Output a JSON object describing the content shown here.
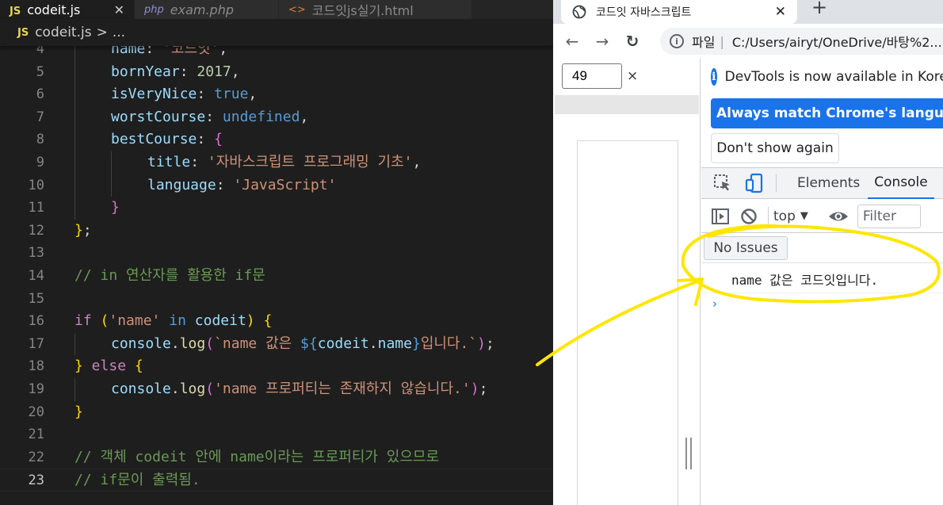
{
  "editor": {
    "tabs": [
      {
        "label": "codeit.js",
        "icon": "JS"
      },
      {
        "label": "exam.php",
        "icon": "php"
      },
      {
        "label": "코드잇js실기.html",
        "icon": "<>"
      }
    ],
    "close_glyph": "✕",
    "breadcrumb": {
      "icon": "JS",
      "file": "codeit.js",
      "sep": ">",
      "rest": "..."
    },
    "line_numbers": [
      "4",
      "5",
      "6",
      "7",
      "8",
      "9",
      "10",
      "11",
      "12",
      "13",
      "14",
      "15",
      "16",
      "17",
      "18",
      "19",
      "20",
      "21",
      "22",
      "23"
    ],
    "code": {
      "l4": {
        "prop": "name",
        "colon": ": ",
        "str": "'코드잇'",
        "end": ","
      },
      "l5": {
        "prop": "bornYear",
        "colon": ": ",
        "num": "2017",
        "end": ","
      },
      "l6": {
        "prop": "isVeryNice",
        "colon": ": ",
        "kw": "true",
        "end": ","
      },
      "l7": {
        "prop": "worstCourse",
        "colon": ": ",
        "kw": "undefined",
        "end": ","
      },
      "l8": {
        "prop": "bestCourse",
        "colon": ": ",
        "brace": "{"
      },
      "l9": {
        "prop": "title",
        "colon": ": ",
        "str": "'자바스크립트 프로그래밍 기초'",
        "end": ","
      },
      "l10": {
        "prop": "language",
        "colon": ": ",
        "str": "'JavaScript'"
      },
      "l11": {
        "brace": "}"
      },
      "l12": {
        "brace": "}",
        "end": ";"
      },
      "l14": {
        "comment": "// in 연산자를 활용한 if문"
      },
      "l16": {
        "kw": "if",
        "sp": " ",
        "paren_open": "(",
        "str": "'name'",
        "in": " in ",
        "obj": "codeit",
        "paren_close": ")",
        "brace": " {"
      },
      "l17": {
        "obj": "console",
        "dot": ".",
        "fn": "log",
        "paren_open": "(",
        "tpl1": "`name 값은 ",
        "tpl_open": "${",
        "obj2": "codeit",
        "dot2": ".",
        "prop": "name",
        "tpl_close": "}",
        "tpl2": "입니다.`",
        "paren_close": ")",
        "end": ";"
      },
      "l18": {
        "brace_close": "}",
        "else": " else ",
        "brace": "{"
      },
      "l19": {
        "obj": "console",
        "dot": ".",
        "fn": "log",
        "paren_open": "(",
        "str": "'name 프로퍼티는 존재하지 않습니다.'",
        "paren_close": ")",
        "end": ";"
      },
      "l20": {
        "brace": "}"
      },
      "l22": {
        "comment": "// 객체 codeit 안에 name이라는 프로퍼티가 있으므로"
      },
      "l23": {
        "comment": "// if문이 출력됨."
      }
    }
  },
  "browser": {
    "tab_title": "코드잇 자바스크립트",
    "tab_close": "✕",
    "new_tab": "+",
    "nav": {
      "back": "←",
      "forward": "→",
      "reload": "↻"
    },
    "omnibox": {
      "info": "i",
      "scheme": "파일",
      "bar": "|",
      "url": "C:/Users/airyt/OneDrive/바탕%2..."
    },
    "page": {
      "number_value": "49",
      "clear_glyph": "×"
    }
  },
  "devtools": {
    "info_icon": "i",
    "info_text": "DevTools is now available in Korean",
    "match_button": "Always match Chrome's language",
    "dont_show_button": "Don't show again",
    "tabs": [
      "Elements",
      "Console"
    ],
    "console_toolbar": {
      "context": "top",
      "context_arrow": "▼",
      "filter_placeholder": "Filter"
    },
    "issues_button": "No Issues",
    "log_line": "name 값은 코드잇입니다.",
    "prompt": "›"
  },
  "colors": {
    "annotation": "#ffe600",
    "chrome_blue": "#1a73e8"
  }
}
